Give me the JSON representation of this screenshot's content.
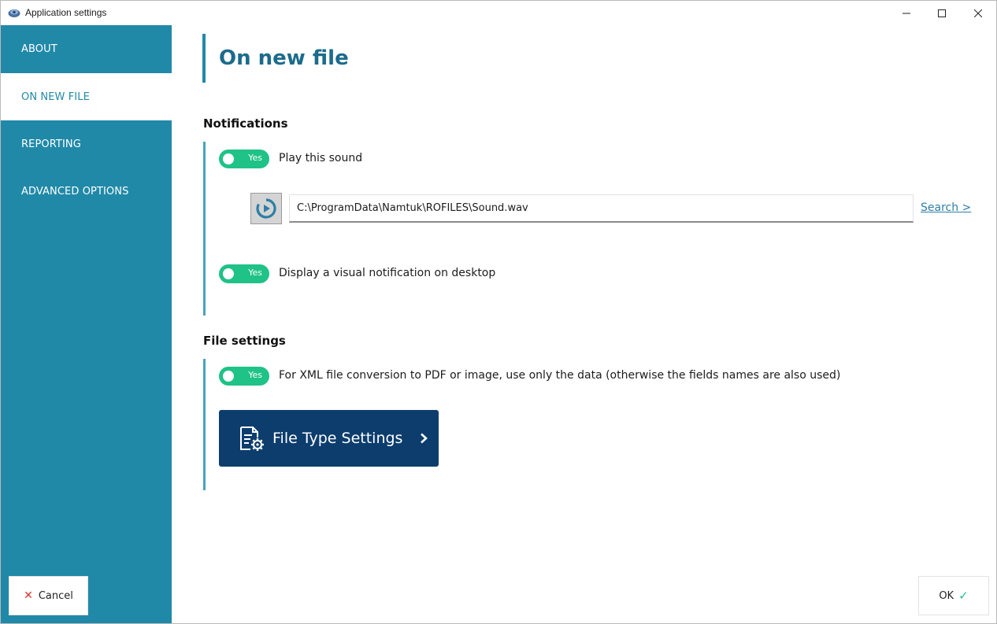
{
  "window": {
    "title": "Application settings"
  },
  "sidebar": {
    "items": [
      {
        "label": "ABOUT"
      },
      {
        "label": "ON NEW FILE"
      },
      {
        "label": "REPORTING"
      },
      {
        "label": "ADVANCED OPTIONS"
      }
    ],
    "active_index": 1,
    "cancel_label": "Cancel"
  },
  "main": {
    "page_title": "On new file",
    "notifications": {
      "title": "Notifications",
      "play_sound": {
        "toggle": "Yes",
        "label": "Play this sound",
        "enabled": true
      },
      "sound_path": "C:\\ProgramData\\Namtuk\\ROFILES\\Sound.wav",
      "search_link": "Search >",
      "visual": {
        "toggle": "Yes",
        "label": "Display a visual notification on desktop",
        "enabled": true
      }
    },
    "file_settings": {
      "title": "File settings",
      "xml_option": {
        "toggle": "Yes",
        "label": "For XML file conversion to PDF or image, use only the data (otherwise the fields names are also used)",
        "enabled": true
      },
      "file_type_button": "File Type Settings"
    },
    "ok_label": "OK"
  },
  "colors": {
    "sidebar": "#2189a8",
    "title": "#1b6b8c",
    "toggle_on": "#1fc287",
    "primary_button": "#0d3d6d",
    "link": "#2d7fa6",
    "cancel_icon": "#d9352f"
  },
  "icons": {
    "app": "app-logo-icon",
    "minimize": "minimize-icon",
    "maximize": "maximize-icon",
    "close": "close-icon",
    "play": "play-sound-icon",
    "file_type": "file-settings-gear-icon",
    "chevron": "chevron-right-icon",
    "cancel": "cancel-x-icon",
    "ok": "checkmark-icon"
  }
}
